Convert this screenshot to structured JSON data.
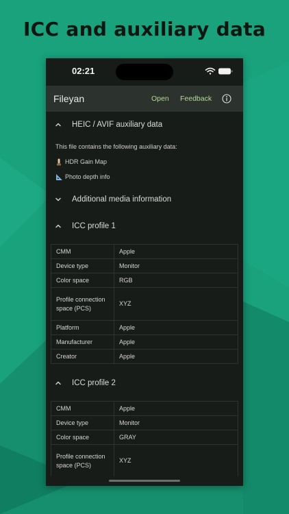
{
  "headline": "ICC and auxiliary data",
  "status": {
    "time": "02:21"
  },
  "app_bar": {
    "title": "Fileyan",
    "open_label": "Open",
    "feedback_label": "Feedback"
  },
  "aux_section": {
    "title": "HEIC / AVIF auxiliary data",
    "intro": "This file contains the following auxiliary data:",
    "items": [
      {
        "icon": "hdr-gain-map-icon",
        "label": "HDR Gain Map"
      },
      {
        "icon": "triangle-ruler-icon",
        "label": "Photo depth info"
      }
    ]
  },
  "media_section": {
    "title": "Additional media information"
  },
  "icc1": {
    "title": "ICC profile 1",
    "rows": [
      {
        "key": "CMM",
        "value": "Apple"
      },
      {
        "key": "Device type",
        "value": "Monitor"
      },
      {
        "key": "Color space",
        "value": "RGB"
      },
      {
        "key": "Profile connection space (PCS)",
        "value": "XYZ"
      },
      {
        "key": "Platform",
        "value": "Apple"
      },
      {
        "key": "Manufacturer",
        "value": "Apple"
      },
      {
        "key": "Creator",
        "value": "Apple"
      }
    ]
  },
  "icc2": {
    "title": "ICC profile 2",
    "rows": [
      {
        "key": "CMM",
        "value": "Apple"
      },
      {
        "key": "Device type",
        "value": "Monitor"
      },
      {
        "key": "Color space",
        "value": "GRAY"
      },
      {
        "key": "Profile connection space (PCS)",
        "value": "XYZ"
      }
    ]
  },
  "colors": {
    "background": "#19a27c",
    "phone_bg": "#171c18",
    "app_bar_bg": "#2c322d",
    "accent": "#b9d99a"
  }
}
